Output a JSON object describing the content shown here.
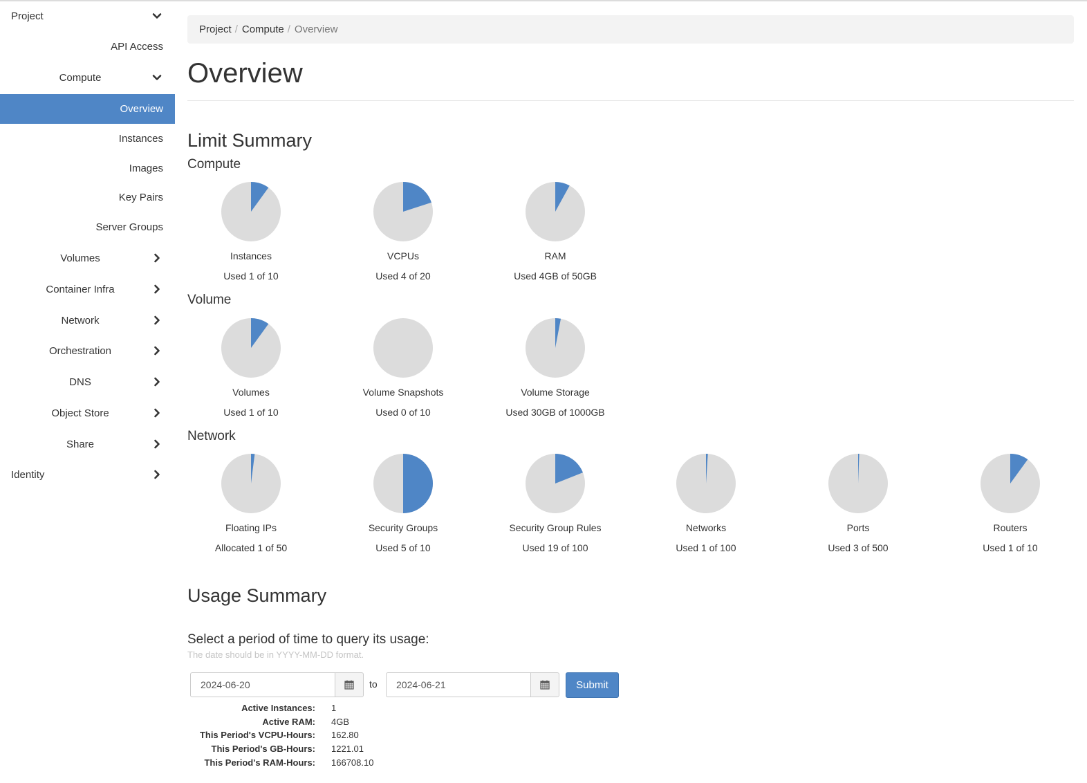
{
  "colors": {
    "accent": "#4f86c6",
    "pie_empty": "#dcdcdc"
  },
  "sidebar": {
    "project": {
      "label": "Project",
      "icon": "chevron-down-icon"
    },
    "api_access": {
      "label": "API Access"
    },
    "compute": {
      "label": "Compute",
      "icon": "chevron-down-icon"
    },
    "compute_items": [
      "Overview",
      "Instances",
      "Images",
      "Key Pairs",
      "Server Groups"
    ],
    "active_item": "Overview",
    "groups": [
      "Volumes",
      "Container Infra",
      "Network",
      "Orchestration",
      "DNS",
      "Object Store",
      "Share"
    ],
    "identity": {
      "label": "Identity",
      "icon": "chevron-right-icon"
    }
  },
  "breadcrumb": [
    "Project",
    "Compute",
    "Overview"
  ],
  "page_title": "Overview",
  "limit_summary": {
    "title": "Limit Summary",
    "compute": {
      "title": "Compute",
      "charts": [
        {
          "label": "Instances",
          "usage": "Used 1 of 10",
          "used": 1,
          "total": 10
        },
        {
          "label": "VCPUs",
          "usage": "Used 4 of 20",
          "used": 4,
          "total": 20
        },
        {
          "label": "RAM",
          "usage": "Used 4GB of 50GB",
          "used": 4,
          "total": 50
        }
      ]
    },
    "volume": {
      "title": "Volume",
      "charts": [
        {
          "label": "Volumes",
          "usage": "Used 1 of 10",
          "used": 1,
          "total": 10
        },
        {
          "label": "Volume Snapshots",
          "usage": "Used 0 of 10",
          "used": 0,
          "total": 10
        },
        {
          "label": "Volume Storage",
          "usage": "Used 30GB of 1000GB",
          "used": 30,
          "total": 1000
        }
      ]
    },
    "network": {
      "title": "Network",
      "charts": [
        {
          "label": "Floating IPs",
          "usage": "Allocated 1 of 50",
          "used": 1,
          "total": 50
        },
        {
          "label": "Security Groups",
          "usage": "Used 5 of 10",
          "used": 5,
          "total": 10
        },
        {
          "label": "Security Group Rules",
          "usage": "Used 19 of 100",
          "used": 19,
          "total": 100
        },
        {
          "label": "Networks",
          "usage": "Used 1 of 100",
          "used": 1,
          "total": 100
        },
        {
          "label": "Ports",
          "usage": "Used 3 of 500",
          "used": 3,
          "total": 500
        },
        {
          "label": "Routers",
          "usage": "Used 1 of 10",
          "used": 1,
          "total": 10
        }
      ]
    }
  },
  "usage_summary": {
    "title": "Usage Summary",
    "query_title": "Select a period of time to query its usage:",
    "help_text": "The date should be in YYYY-MM-DD format.",
    "start_date": "2024-06-20",
    "end_date": "2024-06-21",
    "to_label": "to",
    "submit_label": "Submit",
    "stats": [
      {
        "label": "Active Instances:",
        "value": "1"
      },
      {
        "label": "Active RAM:",
        "value": "4GB"
      },
      {
        "label": "This Period's VCPU-Hours:",
        "value": "162.80"
      },
      {
        "label": "This Period's GB-Hours:",
        "value": "1221.01"
      },
      {
        "label": "This Period's RAM-Hours:",
        "value": "166708.10"
      }
    ]
  }
}
